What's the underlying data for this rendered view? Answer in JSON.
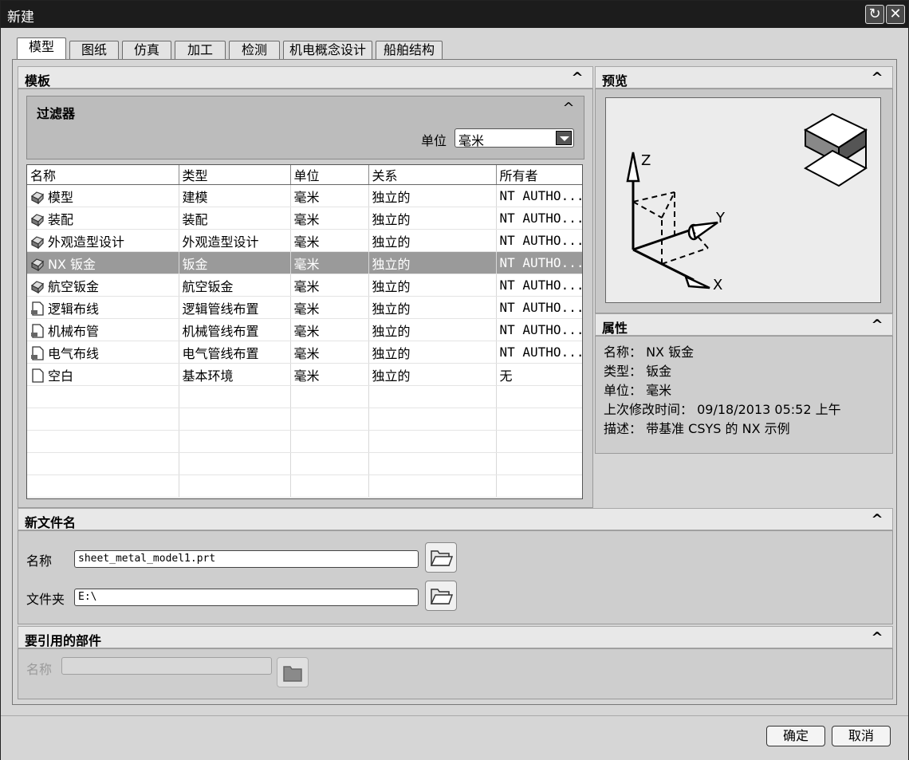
{
  "window": {
    "title": "新建",
    "restore_icon": "↻",
    "close_icon": "✕"
  },
  "tabs": [
    "模型",
    "图纸",
    "仿真",
    "加工",
    "检测",
    "机电概念设计",
    "船舶结构"
  ],
  "template": {
    "title": "模板",
    "filter": {
      "title": "过滤器",
      "unit_label": "单位",
      "unit_value": "毫米"
    },
    "columns": [
      "名称",
      "类型",
      "单位",
      "关系",
      "所有者"
    ],
    "rows": [
      {
        "icon": "model-icon",
        "name": "模型",
        "type": "建模",
        "unit": "毫米",
        "relation": "独立的",
        "owner": "NT AUTHO..."
      },
      {
        "icon": "assembly-icon",
        "name": "装配",
        "type": "装配",
        "unit": "毫米",
        "relation": "独立的",
        "owner": "NT AUTHO..."
      },
      {
        "icon": "shape-studio-icon",
        "name": "外观造型设计",
        "type": "外观造型设计",
        "unit": "毫米",
        "relation": "独立的",
        "owner": "NT AUTHO..."
      },
      {
        "icon": "sheet-metal-icon",
        "name": "NX 钣金",
        "type": "钣金",
        "unit": "毫米",
        "relation": "独立的",
        "owner": "NT AUTHO...",
        "selected": true
      },
      {
        "icon": "aero-sheet-metal-icon",
        "name": "航空钣金",
        "type": "航空钣金",
        "unit": "毫米",
        "relation": "独立的",
        "owner": "NT AUTHO..."
      },
      {
        "icon": "logical-routing-icon",
        "name": "逻辑布线",
        "type": "逻辑管线布置",
        "unit": "毫米",
        "relation": "独立的",
        "owner": "NT AUTHO..."
      },
      {
        "icon": "mechanical-routing-icon",
        "name": "机械布管",
        "type": "机械管线布置",
        "unit": "毫米",
        "relation": "独立的",
        "owner": "NT AUTHO..."
      },
      {
        "icon": "electrical-routing-icon",
        "name": "电气布线",
        "type": "电气管线布置",
        "unit": "毫米",
        "relation": "独立的",
        "owner": "NT AUTHO..."
      },
      {
        "icon": "blank-icon",
        "name": "空白",
        "type": "基本环境",
        "unit": "毫米",
        "relation": "独立的",
        "owner": "无"
      }
    ],
    "empty_rows": 5
  },
  "preview": {
    "title": "预览",
    "axis_x": "X",
    "axis_y": "Y",
    "axis_z": "Z"
  },
  "properties": {
    "title": "属性",
    "lines": [
      "名称： NX 钣金",
      "类型： 钣金",
      "单位： 毫米",
      "上次修改时间： 09/18/2013 05:52 上午",
      "描述： 带基准 CSYS 的 NX 示例"
    ]
  },
  "new_file": {
    "title": "新文件名",
    "name_label": "名称",
    "name_value": "sheet_metal_model1.prt",
    "folder_label": "文件夹",
    "folder_value": "E:\\"
  },
  "ref_part": {
    "title": "要引用的部件",
    "name_label": "名称",
    "name_value": ""
  },
  "footer": {
    "ok": "确定",
    "cancel": "取消"
  },
  "collapse_glyph": "^"
}
